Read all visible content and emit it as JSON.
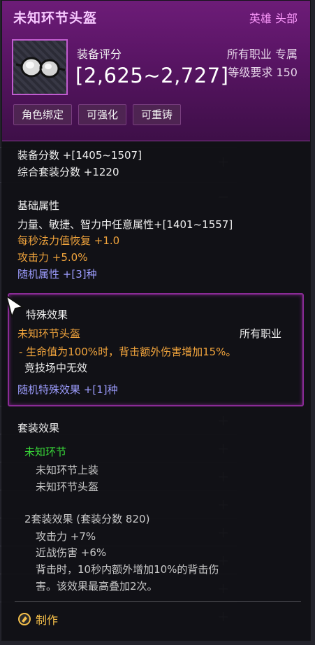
{
  "item": {
    "name": "未知环节头盔",
    "grade_slot": "英雄 头部",
    "score_label": "装备评分",
    "score_range": "[2,625~2,727]",
    "job": "所有职业 专属",
    "level_req": "等级要求 150",
    "tags": [
      "角色绑定",
      "可强化",
      "可重铸"
    ]
  },
  "stats": {
    "equip_score": "装备分数 +[1405~1507]",
    "set_score": "综合套装分数 +1220",
    "base_title": "基础属性",
    "base_1": "力量、敏捷、智力中任意属性+[1401~1557]",
    "base_2": "每秒法力值恢复 +1.0",
    "base_3": "攻击力 +5.0%",
    "base_4": "随机属性 +[3]种"
  },
  "special": {
    "title": "特殊效果",
    "name": "未知环节头盔",
    "job": "所有职业",
    "effect": "- 生命值为100%时，背击额外伤害增加15%。",
    "note": "竞技场中无效",
    "random": "随机特殊效果 +[1]种"
  },
  "set": {
    "title": "套装效果",
    "name": "未知环节",
    "piece_1": "未知环节上装",
    "piece_2": "未知环节头盔",
    "bonus_title": "2套装效果 (套装分数 820)",
    "bonus_1": "攻击力 +7%",
    "bonus_2": "近战伤害 +6%",
    "bonus_3a": "背击时，10秒内额外增加10%的背击伤",
    "bonus_3b": "害。该效果最高叠加2次。"
  },
  "craft_label": "制作",
  "icons": [
    "goggles-icon",
    "cursor-icon",
    "craft-icon"
  ],
  "colors": {
    "hero_purple": "#6d1c78",
    "orange": "#f1a43c",
    "blue": "#9d9dff",
    "green": "#39dd39"
  }
}
